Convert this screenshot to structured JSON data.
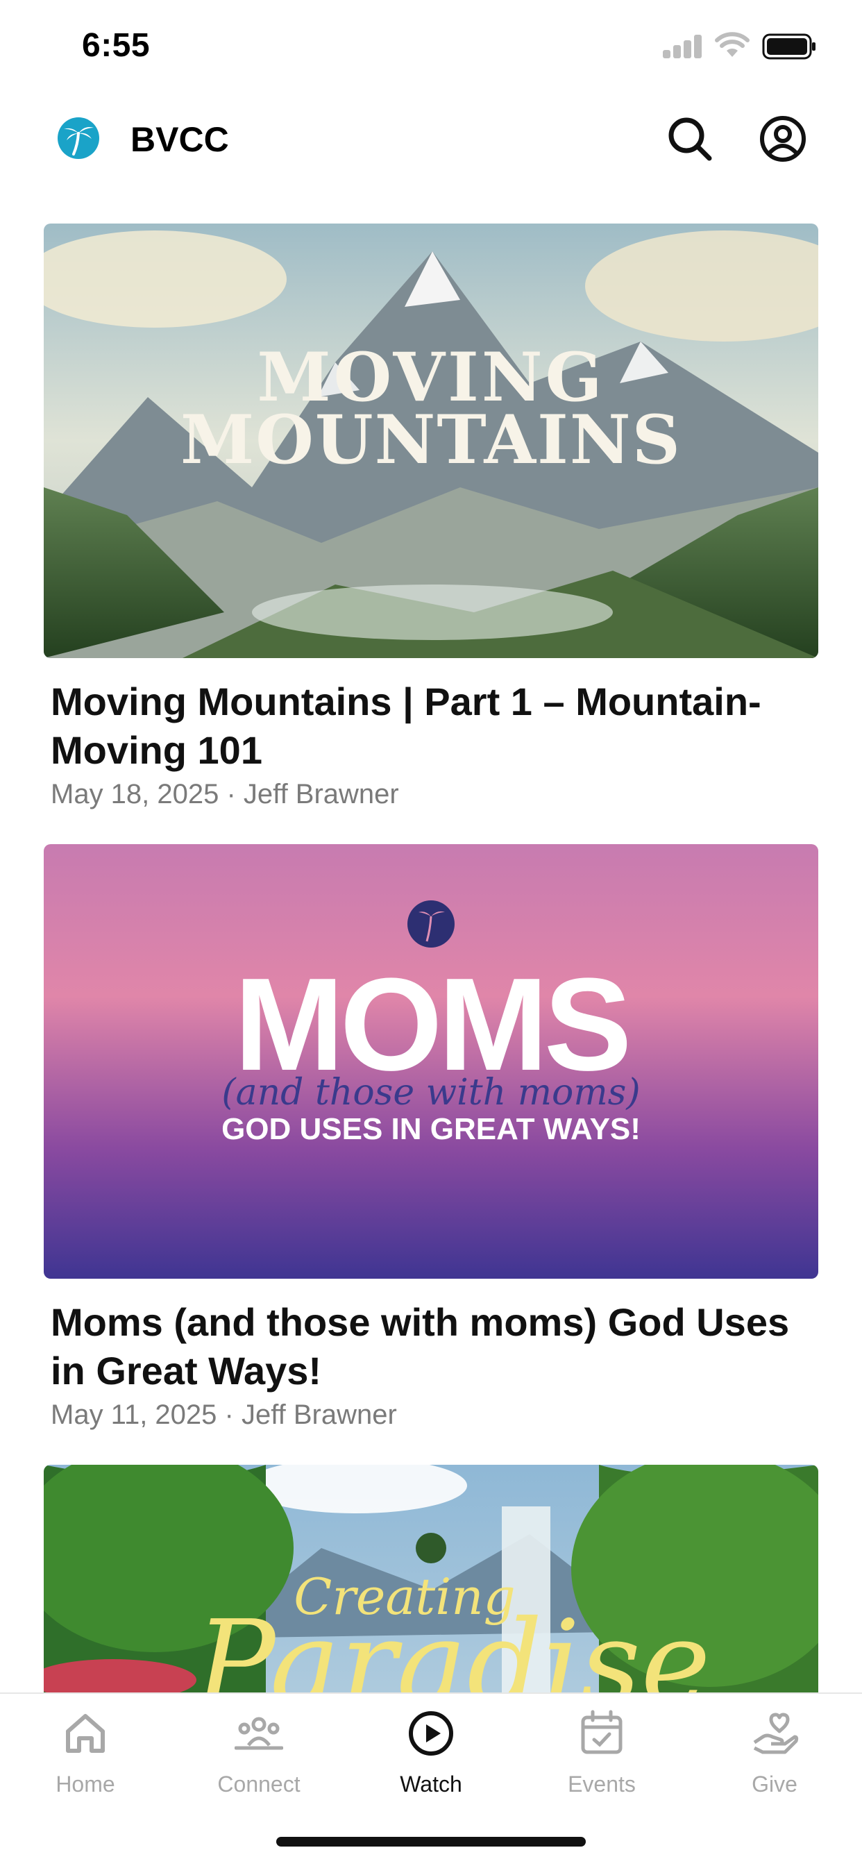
{
  "status": {
    "time": "6:55"
  },
  "header": {
    "title": "BVCC",
    "logo_icon": "palm-tree-logo-icon",
    "brand_color": "#1aa3c8"
  },
  "feed": {
    "items": [
      {
        "artwork_text": "MOVING MOUNTAINS",
        "title": "Moving Mountains | Part 1 – Mountain-Moving 101",
        "meta": "May 18, 2025 · Jeff Brawner"
      },
      {
        "artwork_text": "MOMS",
        "artwork_script": "(and those with moms)",
        "artwork_subtitle": "GOD USES IN GREAT WAYS!",
        "title": "Moms (and those with moms) God Uses in Great Ways!",
        "meta": "May 11, 2025 · Jeff Brawner"
      },
      {
        "artwork_text": "Creating Paradise"
      }
    ]
  },
  "tabs": [
    {
      "label": "Home",
      "icon": "home-icon",
      "active": false
    },
    {
      "label": "Connect",
      "icon": "people-icon",
      "active": false
    },
    {
      "label": "Watch",
      "icon": "play-circle-icon",
      "active": true
    },
    {
      "label": "Events",
      "icon": "calendar-icon",
      "active": false
    },
    {
      "label": "Give",
      "icon": "give-hand-heart-icon",
      "active": false
    }
  ]
}
